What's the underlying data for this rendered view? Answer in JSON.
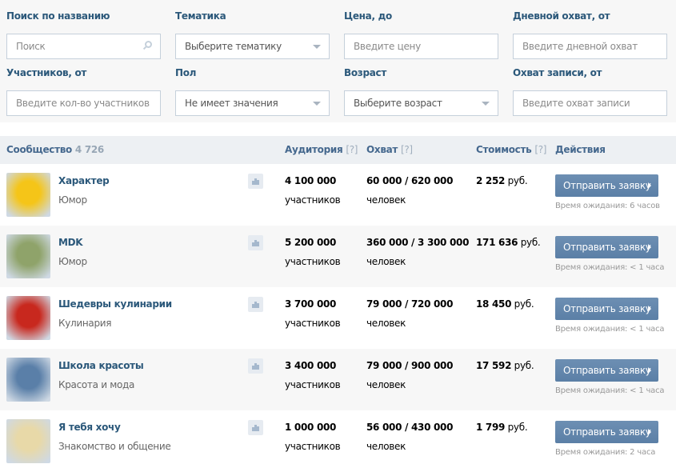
{
  "filters": [
    {
      "label": "Поиск по названию",
      "placeholder": "Поиск",
      "type": "search"
    },
    {
      "label": "Тематика",
      "placeholder": "Выберите тематику",
      "type": "select"
    },
    {
      "label": "Цена, до",
      "placeholder": "Введите цену",
      "type": "text"
    },
    {
      "label": "Дневной охват, от",
      "placeholder": "Введите дневной охват",
      "type": "text"
    },
    {
      "label": "Участников, от",
      "placeholder": "Введите кол-во участников",
      "type": "text"
    },
    {
      "label": "Пол",
      "placeholder": "Не имеет значения",
      "type": "select"
    },
    {
      "label": "Возраст",
      "placeholder": "Выберите возраст",
      "type": "select"
    },
    {
      "label": "Охват записи, от",
      "placeholder": "Введите охват записи",
      "type": "text"
    }
  ],
  "table": {
    "headers": {
      "community": "Сообщество",
      "count": "4 726",
      "audience": "Аудитория",
      "reach": "Охват",
      "cost": "Стоимость",
      "help": "[?]",
      "actions": "Действия"
    },
    "rows": [
      {
        "name": "Характер",
        "category": "Юмор",
        "audience": "4 100 000",
        "audience_unit": "участников",
        "reach": "60 000 / 620 000",
        "reach_unit": "человек",
        "cost": "2 252",
        "currency": "руб.",
        "button": "Отправить заявку",
        "wait": "Время ожидания: 6 часов",
        "avatar_color": "#f5c518"
      },
      {
        "name": "MDK",
        "category": "Юмор",
        "audience": "5 200 000",
        "audience_unit": "участников",
        "reach": "360 000 / 3 300 000",
        "reach_unit": "человек",
        "cost": "171 636",
        "currency": "руб.",
        "button": "Отправить заявку",
        "wait": "Время ожидания: < 1 часа",
        "avatar_color": "#8fa36a"
      },
      {
        "name": "Шедевры кулинарии",
        "category": "Кулинария",
        "audience": "3 700 000",
        "audience_unit": "участников",
        "reach": "79 000 / 720 000",
        "reach_unit": "человек",
        "cost": "18 450",
        "currency": "руб.",
        "button": "Отправить заявку",
        "wait": "Время ожидания: < 1 часа",
        "avatar_color": "#c8281e"
      },
      {
        "name": "Школа красоты",
        "category": "Красота и мода",
        "audience": "3 400 000",
        "audience_unit": "участников",
        "reach": "79 000 / 900 000",
        "reach_unit": "человек",
        "cost": "17 592",
        "currency": "руб.",
        "button": "Отправить заявку",
        "wait": "Время ожидания: < 1 часа",
        "avatar_color": "#5a7fa8"
      },
      {
        "name": "Я тебя хочу",
        "category": "Знакомство и общение",
        "audience": "1 000 000",
        "audience_unit": "участников",
        "reach": "56 000 / 430 000",
        "reach_unit": "человек",
        "cost": "1 799",
        "currency": "руб.",
        "button": "Отправить заявку",
        "wait": "Время ожидания: 2 часа",
        "avatar_color": "#e8d9a8"
      }
    ]
  }
}
